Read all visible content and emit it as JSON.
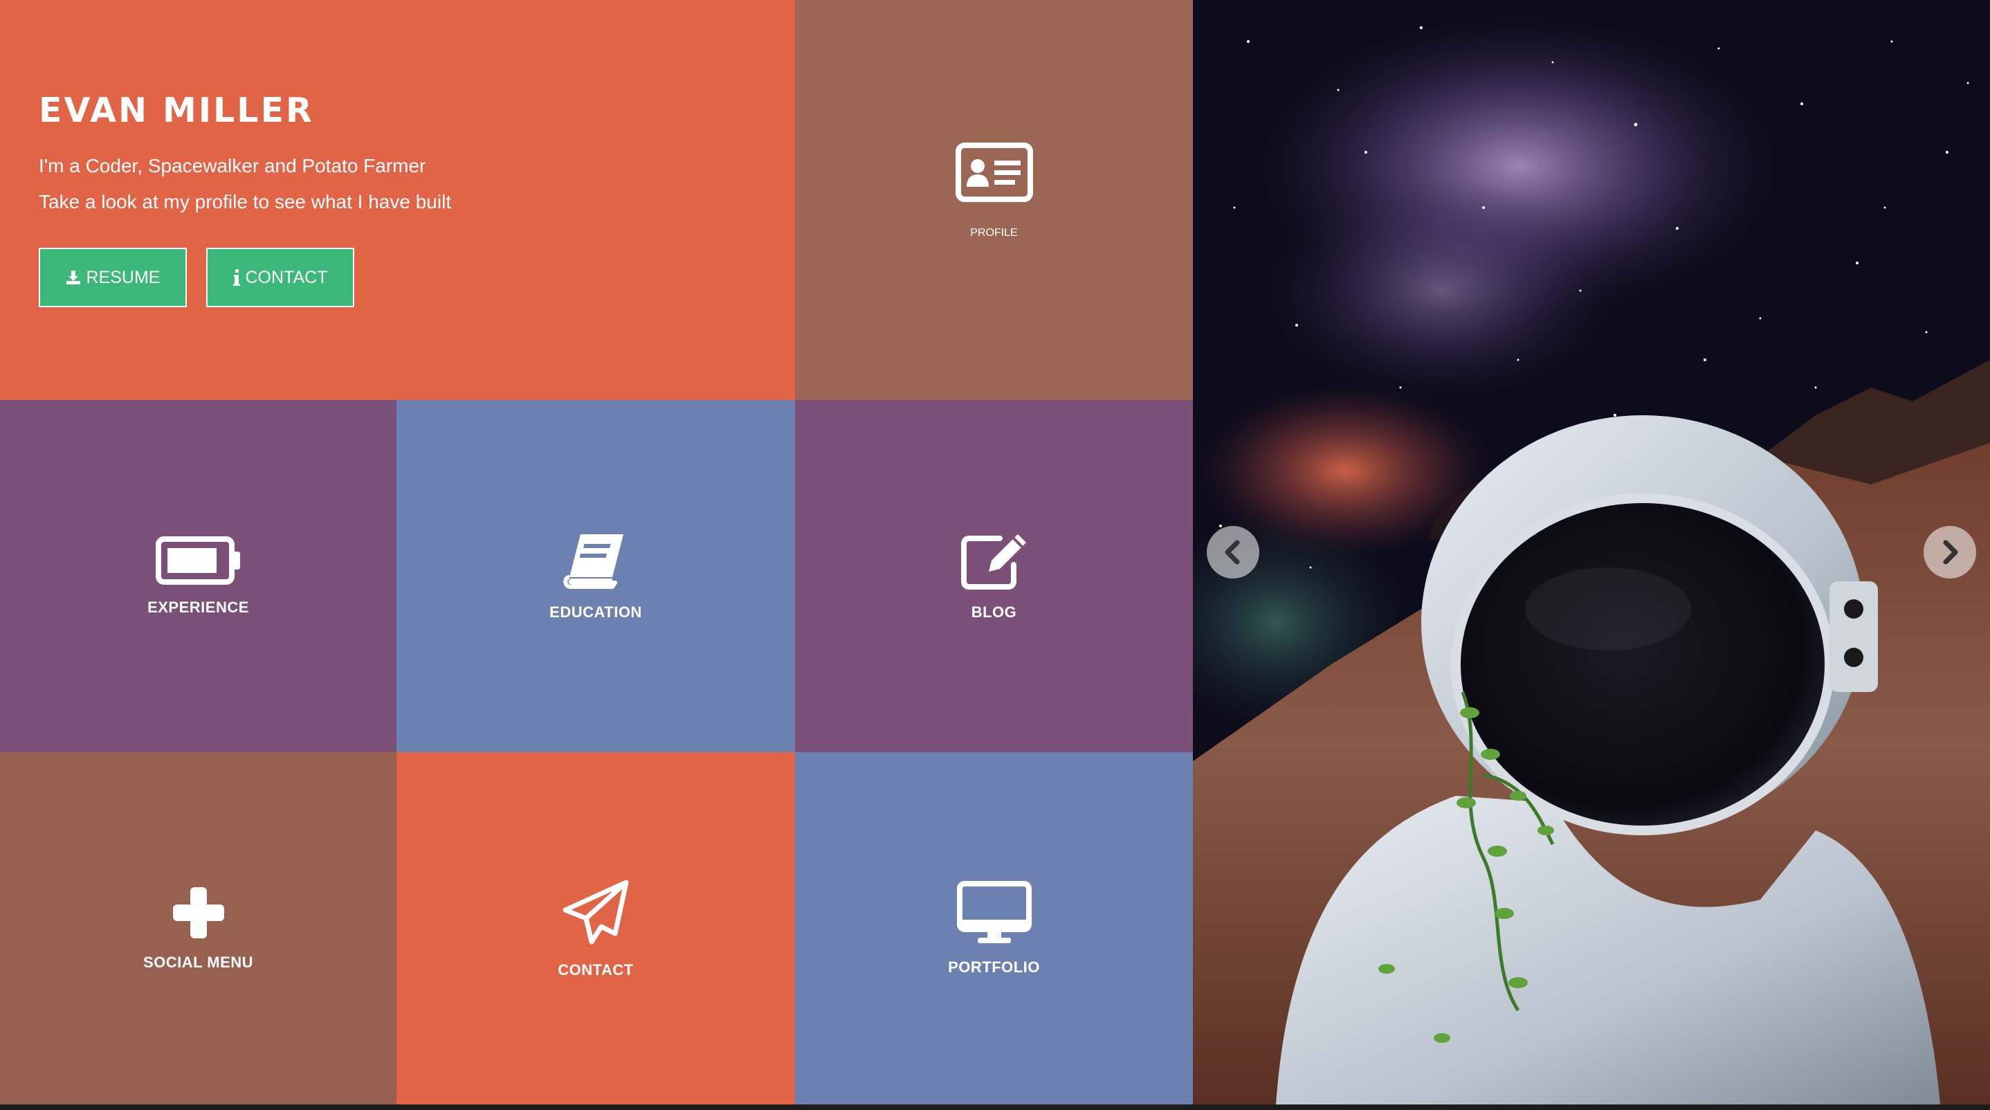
{
  "hero": {
    "name": "EVAN MILLER",
    "tagline_1": "I'm a Coder, Spacewalker and Potato Farmer",
    "tagline_2": "Take a look at my profile to see what I have built",
    "resume_button": "RESUME",
    "contact_button": "CONTACT",
    "resume_icon": "download-icon",
    "contact_icon": "info-icon"
  },
  "menu": {
    "profile": {
      "label": "PROFILE",
      "icon": "id-card-icon"
    },
    "experience": {
      "label": "EXPERIENCE",
      "icon": "battery-icon"
    },
    "education": {
      "label": "EDUCATION",
      "icon": "book-icon"
    },
    "blog": {
      "label": "BLOG",
      "icon": "edit-icon"
    },
    "social": {
      "label": "SOCIAL MENU",
      "icon": "plus-icon"
    },
    "contact": {
      "label": "CONTACT",
      "icon": "paper-plane-icon"
    },
    "portfolio": {
      "label": "PORTFOLIO",
      "icon": "monitor-icon"
    }
  },
  "slider": {
    "image": "astronaut-in-space-photo",
    "prev_icon": "chevron-left-icon",
    "next_icon": "chevron-right-icon"
  },
  "colors": {
    "orange": "#e26447",
    "brown": "#9b6653",
    "purple": "#7a5078",
    "blue": "#6d81b1",
    "green_button": "#3bb87a"
  }
}
